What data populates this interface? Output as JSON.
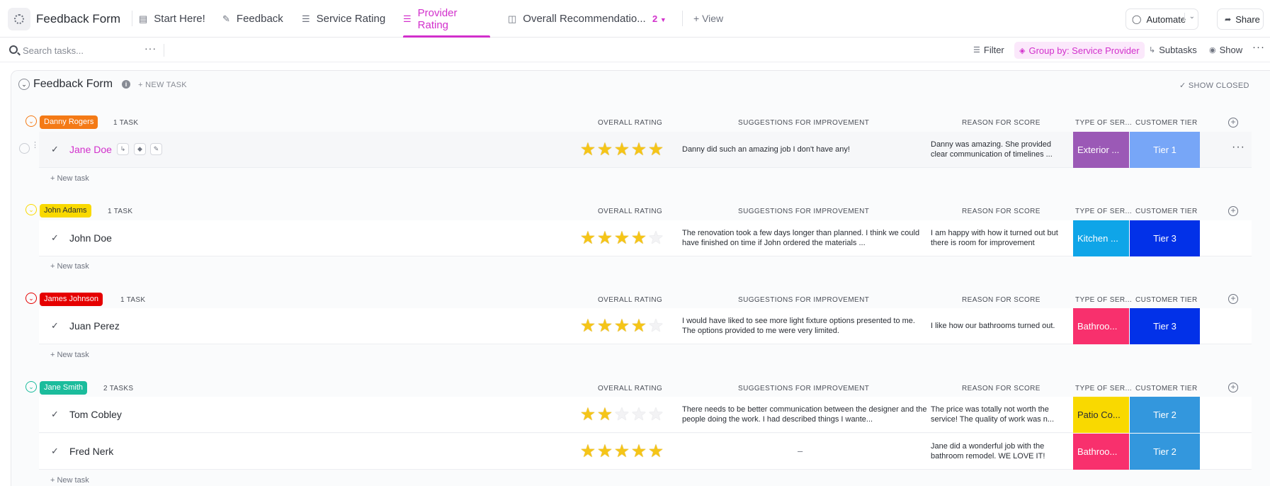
{
  "header": {
    "title": "Feedback Form",
    "views": [
      {
        "label": "Start Here!",
        "icon": "doc-icon"
      },
      {
        "label": "Feedback",
        "icon": "form-icon"
      },
      {
        "label": "Service Rating",
        "icon": "list-icon"
      },
      {
        "label": "Provider Rating",
        "icon": "list-icon",
        "active": true
      },
      {
        "label": "Overall Recommendatio...",
        "icon": "board-icon"
      }
    ],
    "more_views_count": "2",
    "add_view_label": "View",
    "automate_label": "Automate",
    "share_label": "Share"
  },
  "toolbar": {
    "search_placeholder": "Search tasks...",
    "filter_label": "Filter",
    "group_label": "Group by: Service Provider",
    "subtasks_label": "Subtasks",
    "show_label": "Show"
  },
  "list": {
    "title": "Feedback Form",
    "new_task_label": "+ NEW TASK",
    "show_closed_label": "SHOW CLOSED",
    "columns": {
      "rating": "OVERALL RATING",
      "suggestions": "SUGGESTIONS FOR IMPROVEMENT",
      "reason": "REASON FOR SCORE",
      "type": "TYPE OF SER...",
      "tier": "CUSTOMER TIER"
    },
    "row_new_task_label": "+ New task",
    "groups": [
      {
        "name": "Danny Rogers",
        "color": "#f47a16",
        "count_label": "1 TASK",
        "tasks": [
          {
            "name": "Jane Doe",
            "rating": 5,
            "suggestion": "Danny did such an amazing job I don't have any!",
            "reason": "Danny was amazing. She provided clear communication of timelines ...",
            "type": "Exterior ...",
            "type_color": "#9b59b6",
            "tier": "Tier 1",
            "tier_color": "#77a6f7"
          }
        ]
      },
      {
        "name": "John Adams",
        "color": "#f9d900",
        "count_label": "1 TASK",
        "tasks": [
          {
            "name": "John Doe",
            "rating": 4,
            "suggestion": "The renovation took a few days longer than planned. I think we could have finished on time if John ordered the materials ...",
            "reason": "I am happy with how it turned out but there is room for improvement",
            "type": "Kitchen ...",
            "type_color": "#0fa5e8",
            "tier": "Tier 3",
            "tier_color": "#0231e8"
          }
        ]
      },
      {
        "name": "James Johnson",
        "color": "#e50000",
        "count_label": "1 TASK",
        "tasks": [
          {
            "name": "Juan Perez",
            "rating": 4,
            "suggestion": "I would have liked to see more light fixture options presented to me. The options provided to me were very limited.",
            "reason": "I like how our bathrooms turned out.",
            "type": "Bathroo...",
            "type_color": "#f8306d",
            "tier": "Tier 3",
            "tier_color": "#0231e8"
          }
        ]
      },
      {
        "name": "Jane Smith",
        "color": "#1bbc9c",
        "count_label": "2 TASKS",
        "tasks": [
          {
            "name": "Tom Cobley",
            "rating": 2,
            "suggestion": "There needs to be better communication between the designer and the people doing the work. I had described things I wante...",
            "reason": "The price was totally not worth the service! The quality of work was n...",
            "type": "Patio Co...",
            "type_color": "#f9d900",
            "type_text_color": "#292d34",
            "tier": "Tier 2",
            "tier_color": "#3397dd"
          },
          {
            "name": "Fred Nerk",
            "rating": 5,
            "suggestion": "–",
            "reason": "Jane did a wonderful job with the bathroom remodel. WE LOVE IT!",
            "type": "Bathroo...",
            "type_color": "#f8306d",
            "tier": "Tier 2",
            "tier_color": "#3397dd"
          }
        ]
      }
    ]
  }
}
